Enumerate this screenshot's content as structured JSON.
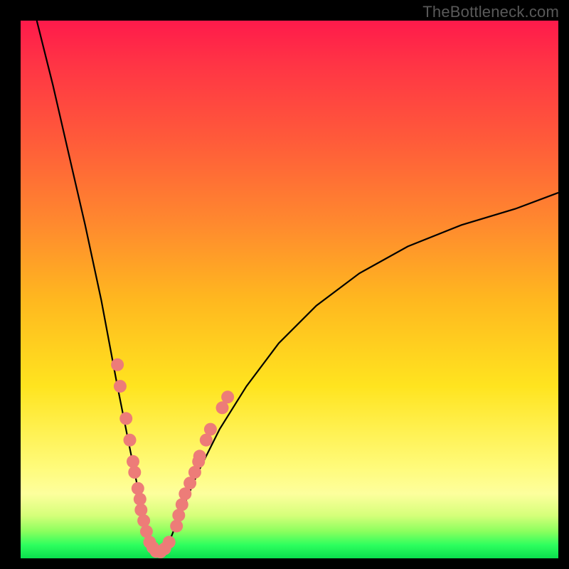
{
  "watermark": "TheBottleneck.com",
  "colors": {
    "frame": "#000000",
    "gradient_top": "#ff1a4b",
    "gradient_mid": "#ffe41f",
    "gradient_bottom": "#0adf4e",
    "curve": "#000000",
    "dots": "#ed7c78"
  },
  "chart_data": {
    "type": "line",
    "title": "",
    "xlabel": "",
    "ylabel": "",
    "xlim": [
      0,
      100
    ],
    "ylim": [
      0,
      100
    ],
    "note": "Bottleneck-style V curve; minimum (0%) near x≈25. Left branch rises steeply toward ~100 at x=0, right branch rises to ~68 at x=100. Background gradient encodes value: red high, green low.",
    "series": [
      {
        "name": "bottleneck-curve",
        "x": [
          3,
          6,
          9,
          12,
          15,
          18,
          20,
          21,
          22,
          23,
          24,
          25,
          26,
          27,
          28,
          30,
          33,
          37,
          42,
          48,
          55,
          63,
          72,
          82,
          92,
          100
        ],
        "y": [
          100,
          88,
          75,
          62,
          48,
          32,
          22,
          17,
          12,
          7,
          3,
          1,
          1,
          2,
          4,
          9,
          16,
          24,
          32,
          40,
          47,
          53,
          58,
          62,
          65,
          68
        ]
      }
    ],
    "annotations": {
      "pink_dots": {
        "description": "Clustered salmon dots along curve near the valley, both branches, roughly 24–37% height band.",
        "points": [
          {
            "x": 18.0,
            "y": 36
          },
          {
            "x": 18.5,
            "y": 32
          },
          {
            "x": 19.6,
            "y": 26
          },
          {
            "x": 20.3,
            "y": 22
          },
          {
            "x": 20.9,
            "y": 18
          },
          {
            "x": 21.2,
            "y": 16
          },
          {
            "x": 21.8,
            "y": 13
          },
          {
            "x": 22.2,
            "y": 11
          },
          {
            "x": 22.4,
            "y": 9
          },
          {
            "x": 22.9,
            "y": 7
          },
          {
            "x": 23.4,
            "y": 5
          },
          {
            "x": 24.0,
            "y": 3
          },
          {
            "x": 24.6,
            "y": 2
          },
          {
            "x": 25.2,
            "y": 1.3
          },
          {
            "x": 26.0,
            "y": 1.2
          },
          {
            "x": 26.8,
            "y": 1.8
          },
          {
            "x": 27.6,
            "y": 3
          },
          {
            "x": 29.0,
            "y": 6
          },
          {
            "x": 29.4,
            "y": 8
          },
          {
            "x": 30.0,
            "y": 10
          },
          {
            "x": 30.6,
            "y": 12
          },
          {
            "x": 31.5,
            "y": 14
          },
          {
            "x": 32.4,
            "y": 16
          },
          {
            "x": 33.1,
            "y": 18
          },
          {
            "x": 33.3,
            "y": 19
          },
          {
            "x": 34.5,
            "y": 22
          },
          {
            "x": 35.3,
            "y": 24
          },
          {
            "x": 37.5,
            "y": 28
          },
          {
            "x": 38.5,
            "y": 30
          }
        ]
      }
    }
  }
}
